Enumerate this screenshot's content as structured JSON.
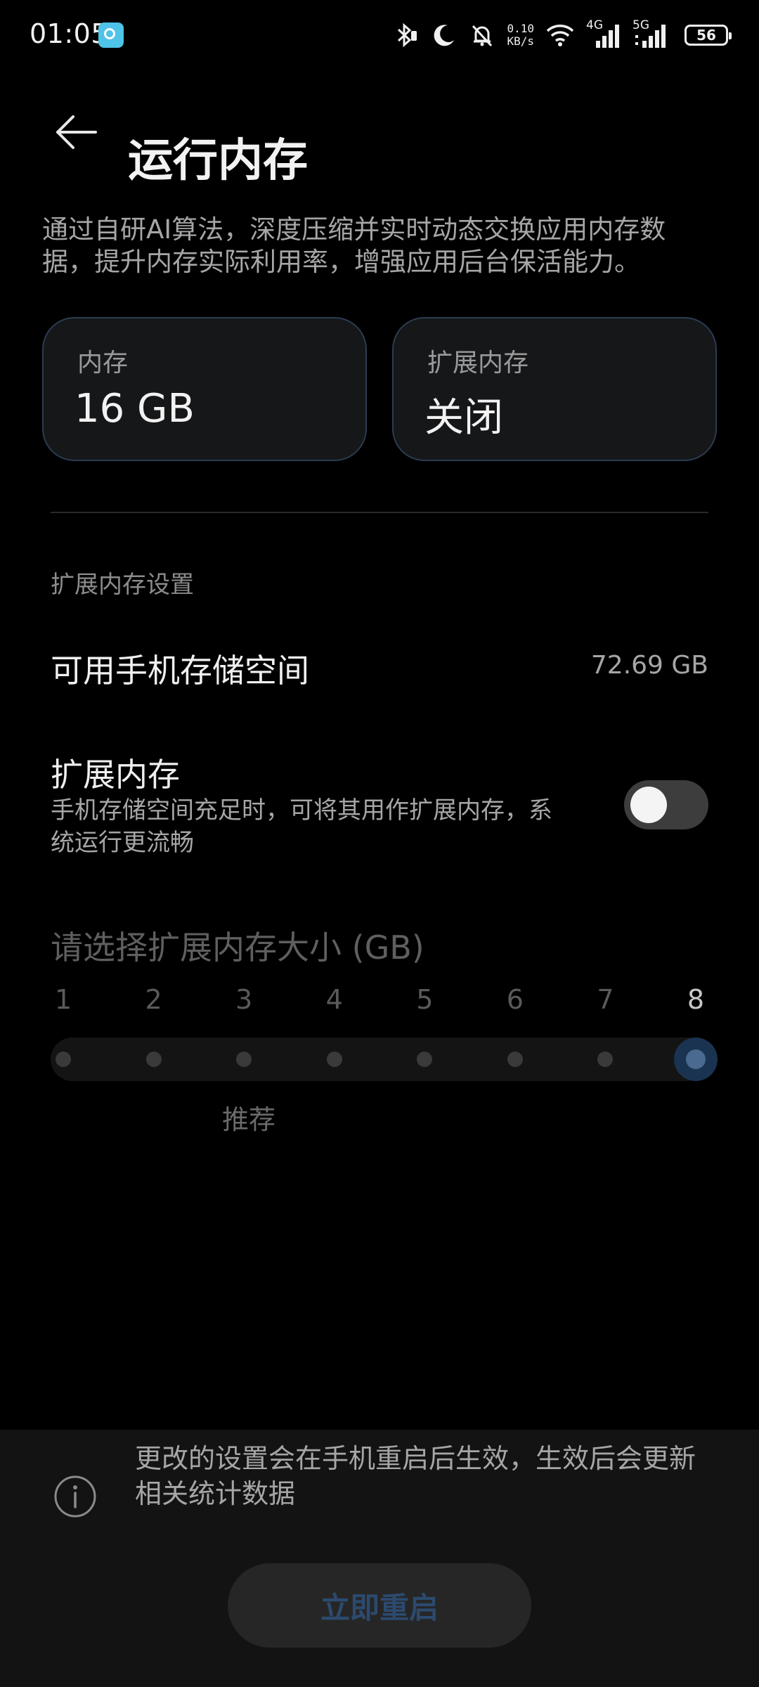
{
  "status_bar": {
    "time": "01:05",
    "net_speed_value": "0.10",
    "net_speed_unit": "KB/s",
    "signal_4g": "4G",
    "signal_5g": "5G",
    "battery": "56"
  },
  "header": {
    "title": "运行内存",
    "description": "通过自研AI算法，深度压缩并实时动态交换应用内存数据，提升内存实际利用率，增强应用后台保活能力。"
  },
  "cards": {
    "memory": {
      "label": "内存",
      "value": "16 GB"
    },
    "extended": {
      "label": "扩展内存",
      "value": "关闭"
    }
  },
  "settings": {
    "section_header": "扩展内存设置",
    "storage": {
      "label": "可用手机存储空间",
      "value": "72.69 GB"
    },
    "extended_memory": {
      "label": "扩展内存",
      "description": "手机存储空间充足时，可将其用作扩展内存，系统运行更流畅",
      "enabled": false
    }
  },
  "slider": {
    "title": "请选择扩展内存大小 (GB)",
    "ticks": [
      "1",
      "2",
      "3",
      "4",
      "5",
      "6",
      "7",
      "8"
    ],
    "selected_value": "8",
    "recommend_label": "推荐",
    "recommended_value": "3"
  },
  "bottom": {
    "note": "更改的设置会在手机重启后生效，生效后会更新相关统计数据",
    "restart_label": "立即重启"
  },
  "colors": {
    "background": "#000000",
    "card_border": "#2b3c52",
    "accent_dim": "#2c4a6e",
    "thumb": "#4a6a8f"
  }
}
